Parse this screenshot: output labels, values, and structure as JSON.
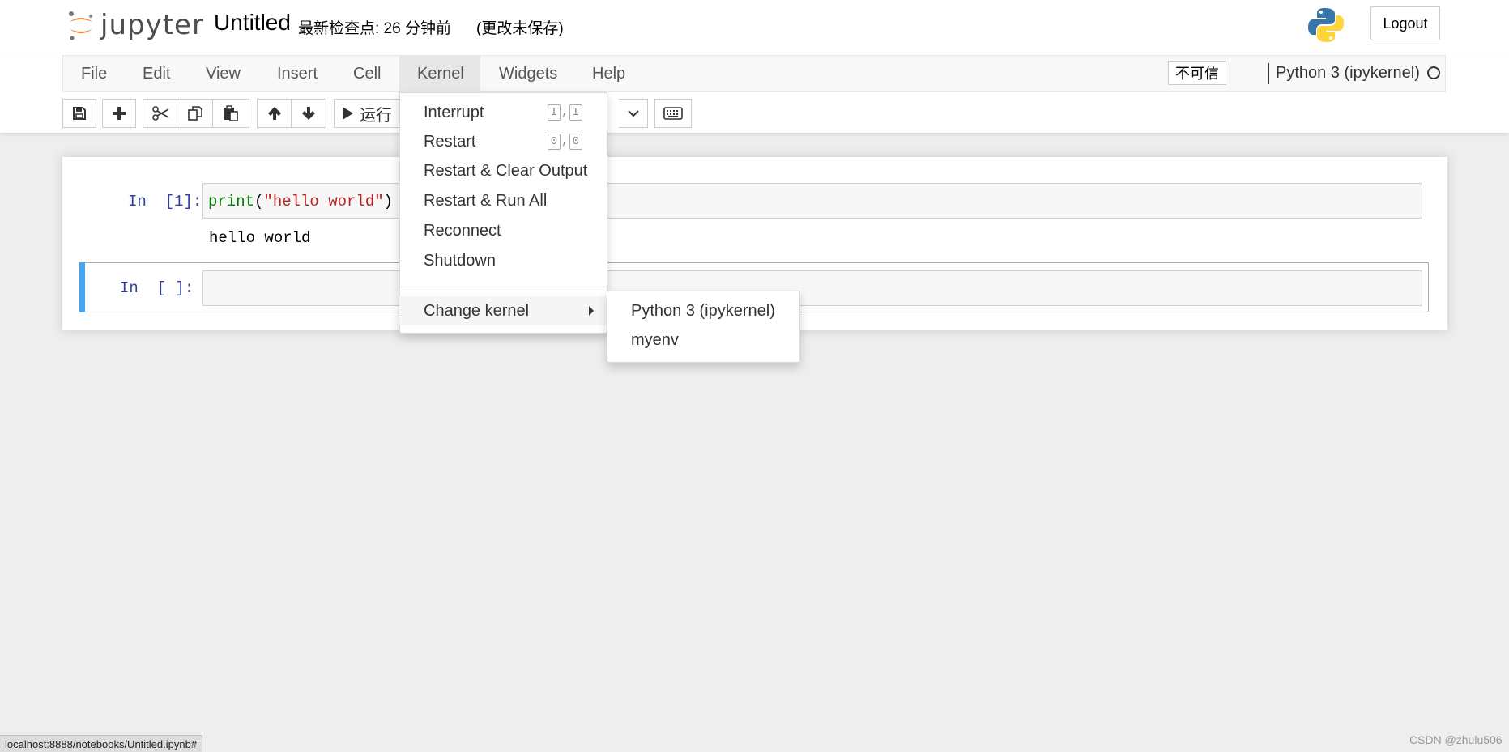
{
  "header": {
    "logo_text": "jupyter",
    "notebook_name": "Untitled",
    "checkpoint": "最新检查点: 26 分钟前",
    "autosave_status": "(更改未保存)",
    "logout_label": "Logout"
  },
  "menubar": {
    "items": [
      "File",
      "Edit",
      "View",
      "Insert",
      "Cell",
      "Kernel",
      "Widgets",
      "Help"
    ],
    "active": "Kernel",
    "trust_label": "不可信",
    "kernel_name": "Python 3 (ipykernel)"
  },
  "toolbar": {
    "run_label": "运行"
  },
  "cells": [
    {
      "prompt": "In  [1]:",
      "code": {
        "fn": "print",
        "open": "(",
        "string": "\"hello world\"",
        "close": ")"
      },
      "output": "hello world"
    },
    {
      "prompt": "In  [ ]:",
      "code": ""
    }
  ],
  "kernel_menu": {
    "items": [
      {
        "label": "Interrupt",
        "shortcut": [
          "I",
          "I"
        ]
      },
      {
        "label": "Restart",
        "shortcut": [
          "0",
          "0"
        ]
      },
      {
        "label": "Restart & Clear Output"
      },
      {
        "label": "Restart & Run All"
      },
      {
        "label": "Reconnect"
      },
      {
        "label": "Shutdown"
      }
    ],
    "change_kernel_label": "Change kernel",
    "submenu": [
      "Python 3 (ipykernel)",
      "myenv"
    ]
  },
  "statusbar": {
    "url": "localhost:8888/notebooks/Untitled.ipynb#",
    "watermark": "CSDN @zhulu506"
  },
  "colors": {
    "selected_cell_bar": "#42a5f5",
    "prompt": "#303f9f",
    "keyword": "#008000",
    "string": "#ba2121"
  }
}
